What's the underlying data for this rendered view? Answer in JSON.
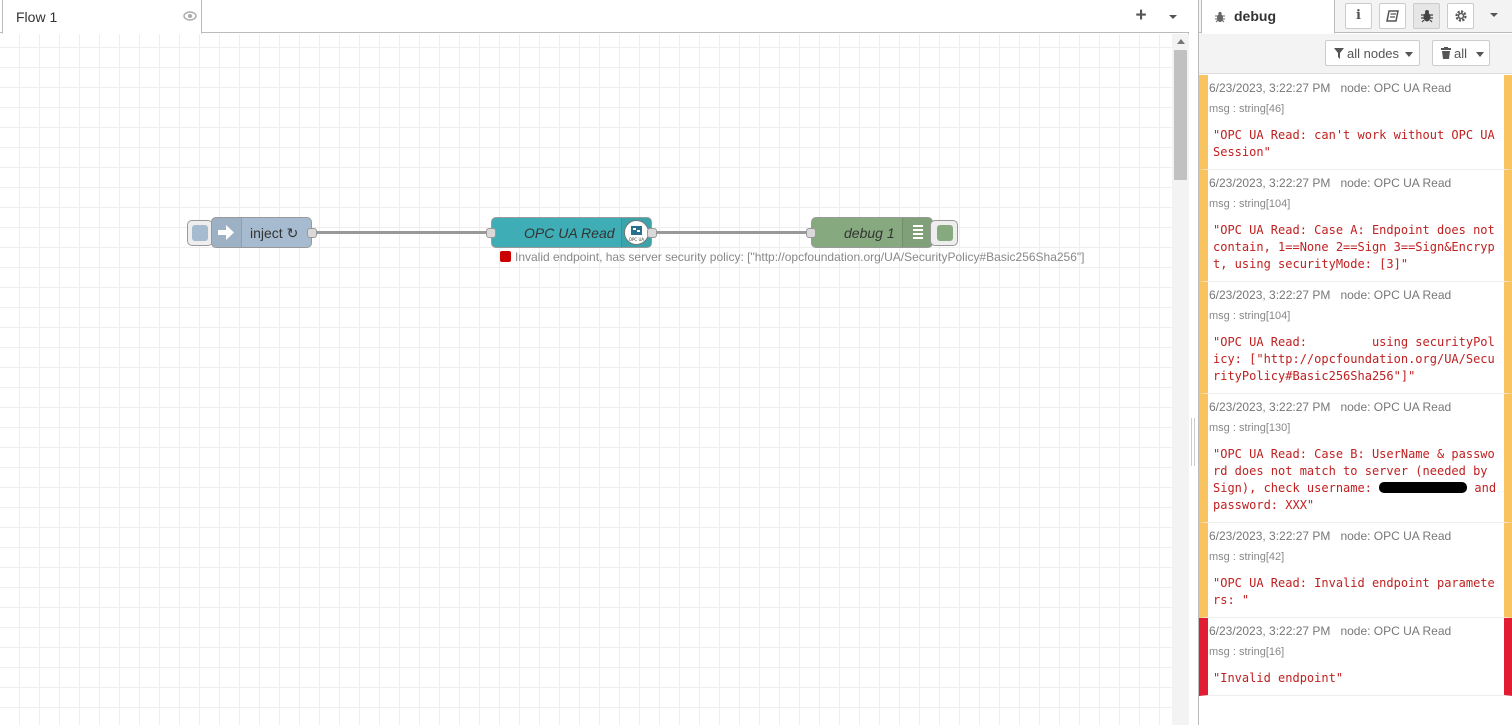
{
  "workspace": {
    "tab_label": "Flow 1",
    "add_tab_glyph": "+",
    "nodes": {
      "inject_label": "inject ↻",
      "opcua_label": "OPC UA Read",
      "debug_label": "debug 1"
    },
    "status_text": "Invalid endpoint, has server security policy: [\"http://opcfoundation.org/UA/SecurityPolicy#Basic256Sha256\"]",
    "node_colors": {
      "inject": "#a6bbcf",
      "opcua": "#3fadb5",
      "debug": "#87a980",
      "status_error": "#cc0000"
    }
  },
  "sidebar": {
    "tab_label": "debug",
    "buttons": [
      "info-icon",
      "book-icon",
      "bug-icon",
      "gear-icon"
    ],
    "filter_label": "all nodes",
    "clear_label": "all",
    "messages": [
      {
        "time": "6/23/2023, 3:22:27 PM",
        "node": "node: OPC UA Read",
        "type": "msg : string",
        "len": "[46]",
        "value": "\"OPC UA Read: can't work without OPC UA Session\"",
        "level": "warn"
      },
      {
        "time": "6/23/2023, 3:22:27 PM",
        "node": "node: OPC UA Read",
        "type": "msg : string",
        "len": "[104]",
        "value": "\"OPC UA Read: Case A: Endpoint does not contain, 1==None 2==Sign 3==Sign&Encrypt, using securityMode: [3]\"",
        "level": "warn"
      },
      {
        "time": "6/23/2023, 3:22:27 PM",
        "node": "node: OPC UA Read",
        "type": "msg : string",
        "len": "[104]",
        "value": "\"OPC UA Read:         using securityPolicy: [\"http://opcfoundation.org/UA/SecurityPolicy#Basic256Sha256\"]\"",
        "level": "warn"
      },
      {
        "time": "6/23/2023, 3:22:27 PM",
        "node": "node: OPC UA Read",
        "type": "msg : string",
        "len": "[130]",
        "value_before": "\"OPC UA Read: Case B: UserName & password does not match to server (needed by Sign), check username: ",
        "value_after": " and password: XXX\"",
        "level": "warn"
      },
      {
        "time": "6/23/2023, 3:22:27 PM",
        "node": "node: OPC UA Read",
        "type": "msg : string",
        "len": "[42]",
        "value": "\"OPC UA Read: Invalid endpoint parameters: \"",
        "level": "warn"
      },
      {
        "time": "6/23/2023, 3:22:27 PM",
        "node": "node: OPC UA Read",
        "type": "msg : string",
        "len": "[16]",
        "value": "\"Invalid endpoint\"",
        "level": "error"
      }
    ],
    "level_colors": {
      "warn": "#f9c460",
      "error": "#e21d33"
    }
  }
}
